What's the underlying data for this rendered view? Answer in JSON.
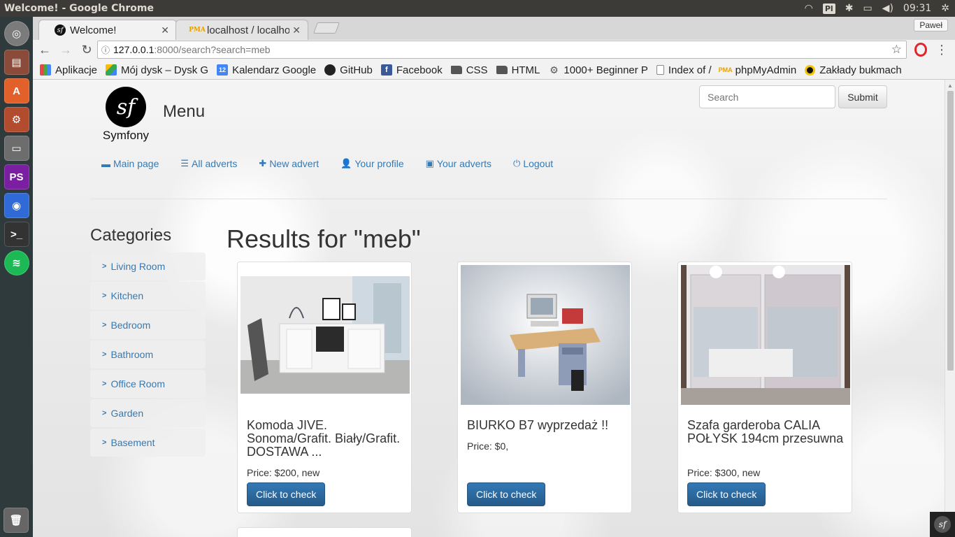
{
  "os": {
    "window_title": "Welcome! - Google Chrome",
    "keyboard_layout": "Pl",
    "time": "09:31"
  },
  "launcher": [
    "dash-icon",
    "files-icon",
    "software-center-icon",
    "settings-icon",
    "disk-icon",
    "phpstorm-icon",
    "chrome-icon",
    "terminal-icon",
    "spotify-icon",
    "trash-icon"
  ],
  "browser": {
    "tabs": [
      {
        "label": "Welcome!",
        "active": true
      },
      {
        "label": "localhost / localhos",
        "active": false
      }
    ],
    "user_badge": "Paweł",
    "url_host": "127.0.0.1",
    "url_rest": ":8000/search?search=meb",
    "bookmarks": [
      {
        "label": "Aplikacje",
        "icon": "apps-icon"
      },
      {
        "label": "Mój dysk – Dysk G",
        "icon": "drive-icon"
      },
      {
        "label": "Kalendarz Google",
        "icon": "calendar-icon"
      },
      {
        "label": "GitHub",
        "icon": "github-icon"
      },
      {
        "label": "Facebook",
        "icon": "facebook-icon"
      },
      {
        "label": "CSS",
        "icon": "folder-icon"
      },
      {
        "label": "HTML",
        "icon": "folder-icon"
      },
      {
        "label": "1000+ Beginner P",
        "icon": "gear-icon"
      },
      {
        "label": "Index of /",
        "icon": "document-icon"
      },
      {
        "label": "phpMyAdmin",
        "icon": "pma-icon"
      },
      {
        "label": "Zakłady bukmach",
        "icon": "ring-icon"
      }
    ],
    "calendar_day": "12"
  },
  "site": {
    "logo_text": "Symfony",
    "menu_title": "Menu",
    "search_placeholder": "Search",
    "submit_label": "Submit",
    "nav": [
      {
        "label": "Main page",
        "icon": "home-icon"
      },
      {
        "label": "All adverts",
        "icon": "list-icon"
      },
      {
        "label": "New advert",
        "icon": "plus-icon"
      },
      {
        "label": "Your profile",
        "icon": "user-icon"
      },
      {
        "label": "Your adverts",
        "icon": "inbox-icon"
      },
      {
        "label": "Logout",
        "icon": "power-icon"
      }
    ],
    "categories_title": "Categories",
    "categories": [
      "Living Room",
      "Kitchen",
      "Bedroom",
      "Bathroom",
      "Office Room",
      "Garden",
      "Basement"
    ],
    "results_title": "Results for \"meb\"",
    "products": [
      {
        "title": "Komoda JIVE. Sonoma/Grafit. Biały/Grafit. DOSTAWA ...",
        "price": "Price: $200, new",
        "button": "Click to check"
      },
      {
        "title": "BIURKO B7 wyprzedaż !!",
        "price": "Price: $0,",
        "button": "Click to check"
      },
      {
        "title": "Szafa garderoba CALIA POŁYSK 194cm przesuwna",
        "price": "Price: $300, new",
        "button": "Click to check"
      }
    ]
  }
}
